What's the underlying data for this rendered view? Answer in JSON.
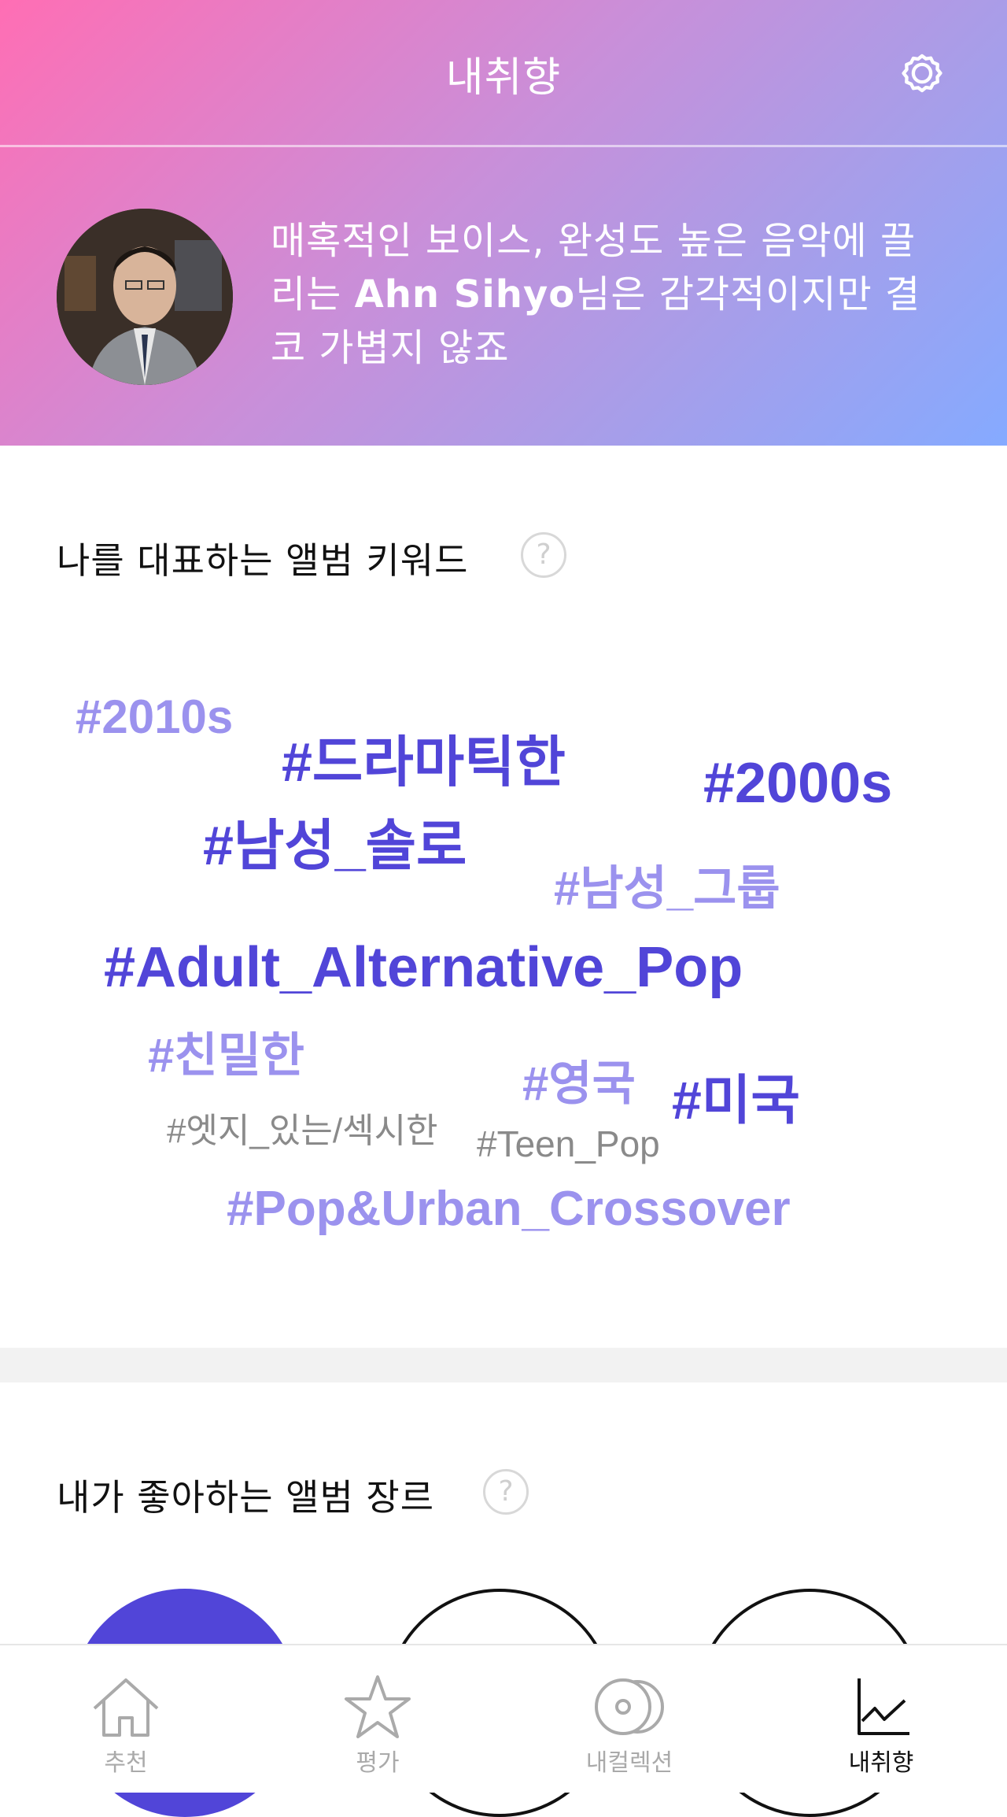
{
  "header": {
    "title": "내취향"
  },
  "profile": {
    "line1": "매혹적인 보이스, 완성도 높은 음악에 끌",
    "line2_pre": "리는 ",
    "user_name": "Ahn Sihyo",
    "line2_post": "님은 감각적이지만 결",
    "line3": "코 가볍지 않죠"
  },
  "keywords_section": {
    "title": "나를 대표하는 앨범 키워드",
    "help": "?",
    "tags": [
      {
        "text": "#2010s",
        "style": "light"
      },
      {
        "text": "#드라마틱한",
        "style": "dark"
      },
      {
        "text": "#2000s",
        "style": "dark"
      },
      {
        "text": "#남성_솔로",
        "style": "dark"
      },
      {
        "text": "#남성_그룹",
        "style": "light"
      },
      {
        "text": "#Adult_Alternative_Pop",
        "style": "dark"
      },
      {
        "text": "#친밀한",
        "style": "light"
      },
      {
        "text": "#영국",
        "style": "light"
      },
      {
        "text": "#미국",
        "style": "dark"
      },
      {
        "text": "#엣지_있는/섹시한",
        "style": "gray"
      },
      {
        "text": "#Teen_Pop",
        "style": "gray"
      },
      {
        "text": "#Pop&Urban_Crossover",
        "style": "light"
      }
    ]
  },
  "genres_section": {
    "title": "내가 좋아하는 앨범 장르",
    "help": "?"
  },
  "bottom_nav": {
    "items": [
      {
        "label": "추천",
        "icon": "home-icon",
        "active": false
      },
      {
        "label": "평가",
        "icon": "star-icon",
        "active": false
      },
      {
        "label": "내컬렉션",
        "icon": "disc-icon",
        "active": false
      },
      {
        "label": "내취향",
        "icon": "chart-icon",
        "active": true
      }
    ]
  },
  "colors": {
    "accent_dark": "#5145d8",
    "accent_light": "#9b92ee",
    "tag_gray": "#8a8a8a",
    "gradient_start": "#ff6eb4",
    "gradient_end": "#85aaff"
  }
}
